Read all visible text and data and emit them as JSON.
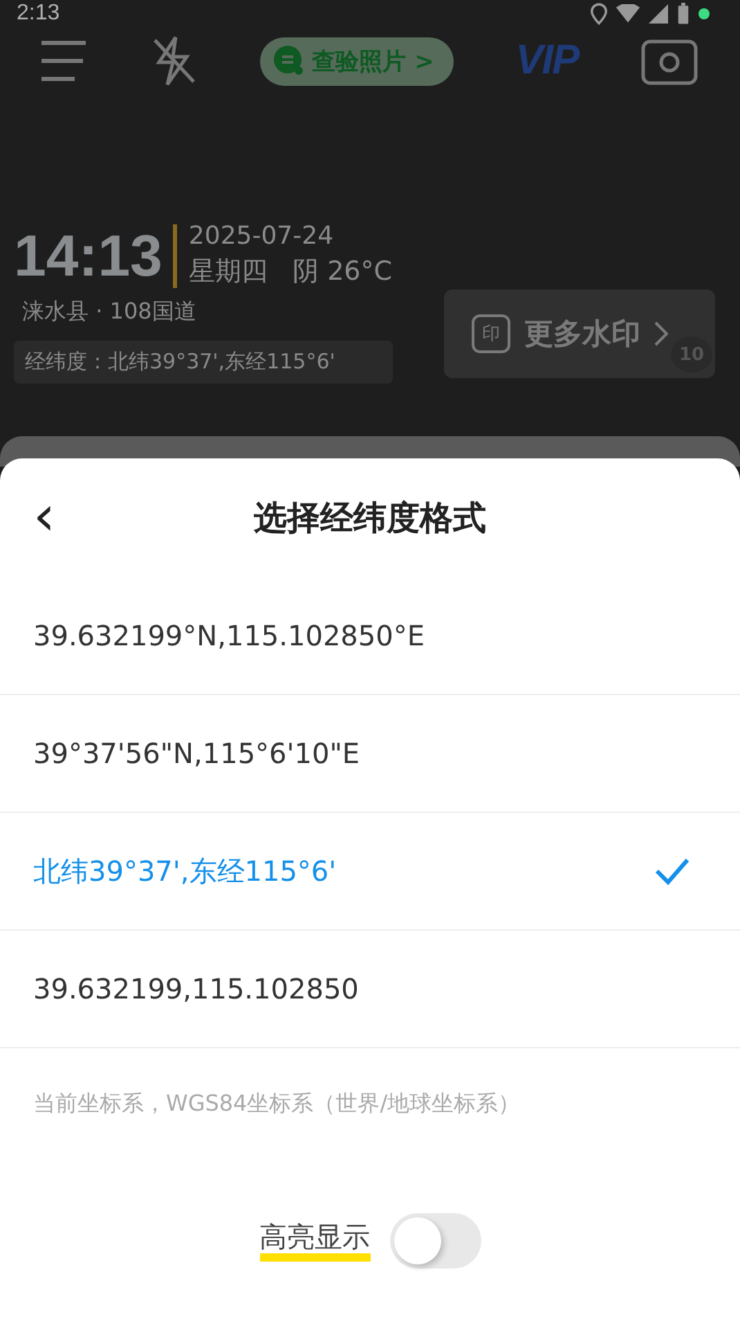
{
  "status_bar": {
    "time": "2:13"
  },
  "top_bar": {
    "verify_button": "查验照片 >",
    "vip": "VIP"
  },
  "watermark": {
    "time": "14:13",
    "date": "2025-07-24",
    "weekday_weather": "星期四   阴 26°C",
    "location": "涞水县 · 108国道",
    "coordinates": "经纬度：北纬39°37',东经115°6'"
  },
  "more_watermarks": {
    "label": "更多水印",
    "badge": "10",
    "stamp": "印"
  },
  "sheet": {
    "back": "‹",
    "title": "选择经纬度格式",
    "options": [
      {
        "label": "39.632199°N,115.102850°E",
        "selected": false
      },
      {
        "label": "39°37'56\"N,115°6'10\"E",
        "selected": false
      },
      {
        "label": "北纬39°37',东经115°6'",
        "selected": true
      },
      {
        "label": "39.632199,115.102850",
        "selected": false
      }
    ],
    "note": "当前坐标系，WGS84坐标系（世界/地球坐标系）",
    "highlight": {
      "label": "高亮显示",
      "on": false
    }
  }
}
